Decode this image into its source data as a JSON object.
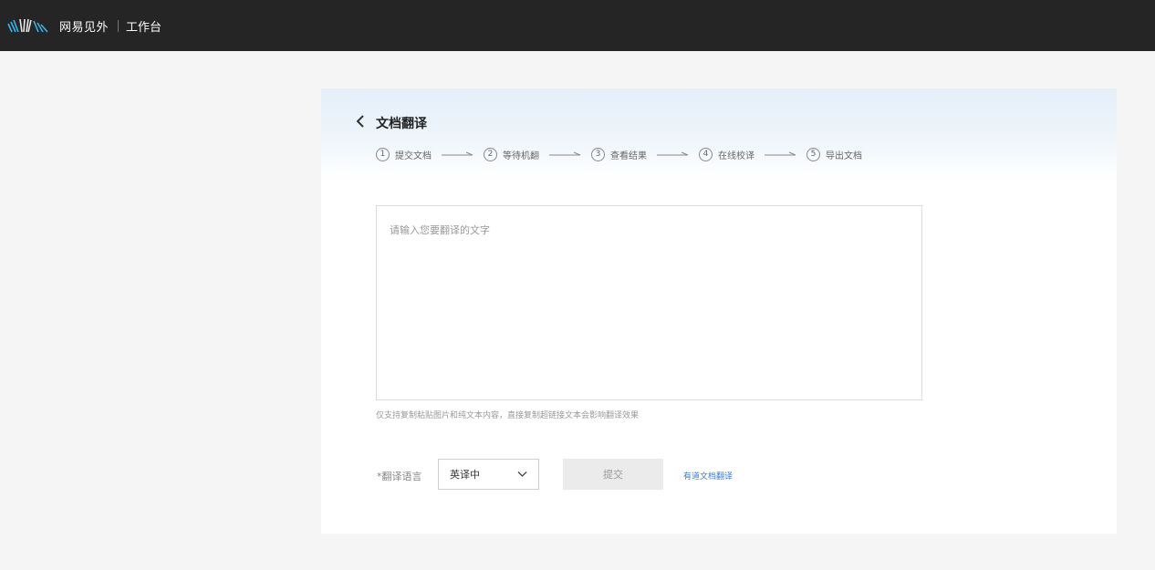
{
  "topbar": {
    "logo_icon": "waveform-logo-icon",
    "brand": "网易见外",
    "workbench": "工作台"
  },
  "page": {
    "back_icon": "chevron-left-icon",
    "title": "文档翻译"
  },
  "steps": [
    {
      "num": "1",
      "label": "提交文档"
    },
    {
      "num": "2",
      "label": "等待机翻"
    },
    {
      "num": "3",
      "label": "查看结果"
    },
    {
      "num": "4",
      "label": "在线校译"
    },
    {
      "num": "5",
      "label": "导出文档"
    }
  ],
  "input": {
    "placeholder": "请输入您要翻译的文字",
    "value": ""
  },
  "hint": "仅支持复制粘贴图片和纯文本内容，直接复制超链接文本会影响翻译效果",
  "language": {
    "label": "*翻译语言",
    "selected": "英译中",
    "chevron_icon": "chevron-down-icon"
  },
  "submit_label": "提交",
  "youdao_link": "有道文档翻译",
  "colors": {
    "topbar_bg": "#252525",
    "link": "#3a7bd5",
    "submit_bg": "#ebebeb"
  }
}
